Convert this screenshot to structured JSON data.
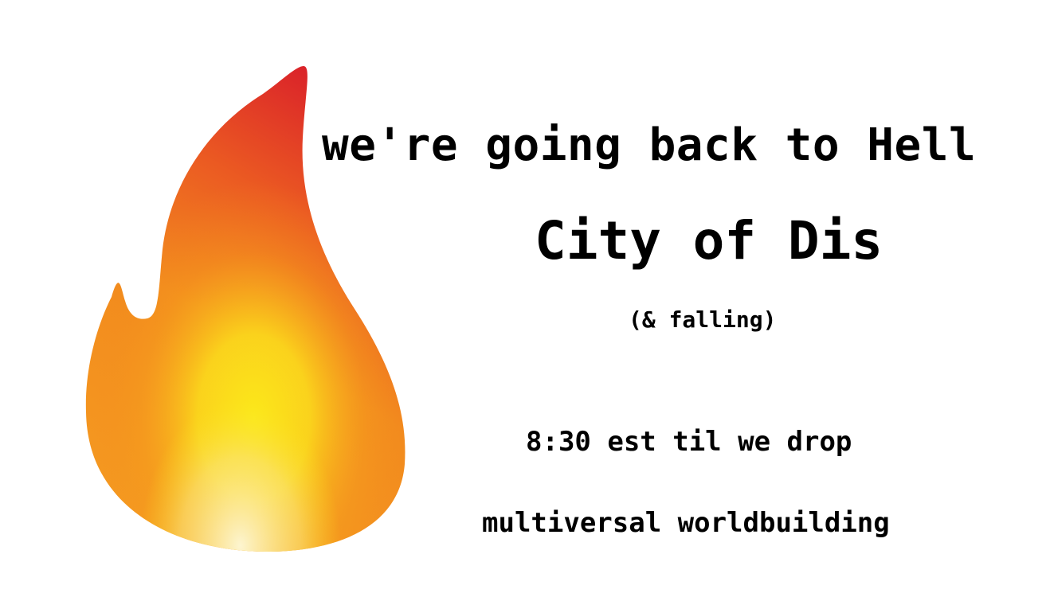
{
  "headline": "we're going back to Hell",
  "title": "City of Dis",
  "subtitle": "(& falling)",
  "time_text": "8:30 est til we drop",
  "topic": "multiversal worldbuilding",
  "graphic": {
    "icon": "fire-icon",
    "colors": {
      "tip": "#d91f2a",
      "outer": "#f0771e",
      "middle": "#f7a21c",
      "core": "#fbe81a",
      "base": "#fdf5d0"
    }
  }
}
